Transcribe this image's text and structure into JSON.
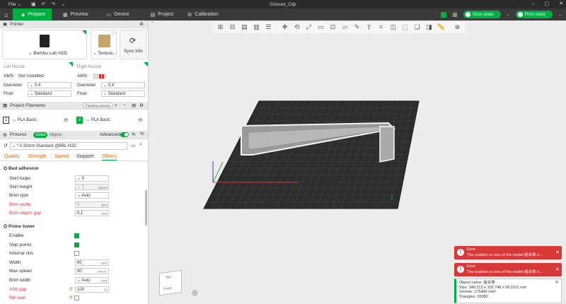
{
  "titlebar": {
    "file": "File",
    "title": "Closure_Clip"
  },
  "nav": {
    "tabs": [
      {
        "label": "Prepare"
      },
      {
        "label": "Preview"
      },
      {
        "label": "Device"
      },
      {
        "label": "Project"
      },
      {
        "label": "Calibration"
      }
    ],
    "slice_plate": "Slice plate",
    "print_plate": "Print plate"
  },
  "printer": {
    "section": "Printer",
    "name": "Bambu Lab H2D",
    "texture": "Texture...",
    "sync": "Sync info"
  },
  "nozzles": {
    "left": {
      "title": "Left Nozzle",
      "ams_label": "AMS",
      "ams_value": "Not installed",
      "diameter_label": "Diameter",
      "diameter": "0.4",
      "flow_label": "Flow",
      "flow": "Standard"
    },
    "right": {
      "title": "Right Nozzle",
      "ams_label": "AMS",
      "diameter_label": "Diameter",
      "diameter": "0.4",
      "flow_label": "Flow",
      "flow": "Standard"
    }
  },
  "filaments": {
    "section": "Project Filaments",
    "flushing": "Flushing volumes",
    "items": [
      {
        "index": "1",
        "name": "PLA Basic"
      },
      {
        "index": "2",
        "name": "PLA Basic"
      }
    ]
  },
  "process": {
    "section": "Process",
    "global": "Global",
    "objects": "Objects",
    "advanced": "Advanced",
    "preset": "* 0.20mm Standard @BBL H2D",
    "tabs": [
      "Quality",
      "Strength",
      "Speed",
      "Support",
      "Others"
    ]
  },
  "bed_adhesion": {
    "title": "Bed adhesion",
    "skirt_loops_label": "Skirt loops",
    "skirt_loops": "0",
    "skirt_height_label": "Skirt height",
    "skirt_height": "1",
    "skirt_height_unit": "layers",
    "brim_type_label": "Brim type",
    "brim_type": "Auto",
    "brim_width_label": "Brim width",
    "brim_width": "5",
    "brim_width_unit": "mm",
    "brim_gap_label": "Brim-object gap",
    "brim_gap": "0.1",
    "brim_gap_unit": "mm"
  },
  "prime_tower": {
    "title": "Prime tower",
    "enable_label": "Enable",
    "skip_label": "Skip points",
    "ribs_label": "Internal ribs",
    "width_label": "Width",
    "width": "60",
    "width_unit": "mm",
    "speed_label": "Max speed",
    "speed": "90",
    "speed_unit": "mm/s",
    "brim_label": "Brim width",
    "brim": "Auto",
    "brim_unit": "mm",
    "infill_label": "Infill gap",
    "infill": "100",
    "infill_unit": "%",
    "rib_label": "Rib wall"
  },
  "toasts": [
    {
      "title": "Error",
      "msg": "The position or size of the model 組合体 e..."
    },
    {
      "title": "Error",
      "msg": "The position or size of the model 組合体 e..."
    }
  ],
  "info": {
    "name": "Object name: 組合体",
    "size": "Size: 340.213 x 105.748 x 26.2211 mm",
    "volume": "Volume: 175446 mm³",
    "triangles": "Triangles: 20082"
  },
  "viewcube": {
    "top": "Top",
    "front": "Front"
  },
  "plate_label": "1",
  "colors": {
    "accent": "#00ae42",
    "error": "#d73838"
  }
}
